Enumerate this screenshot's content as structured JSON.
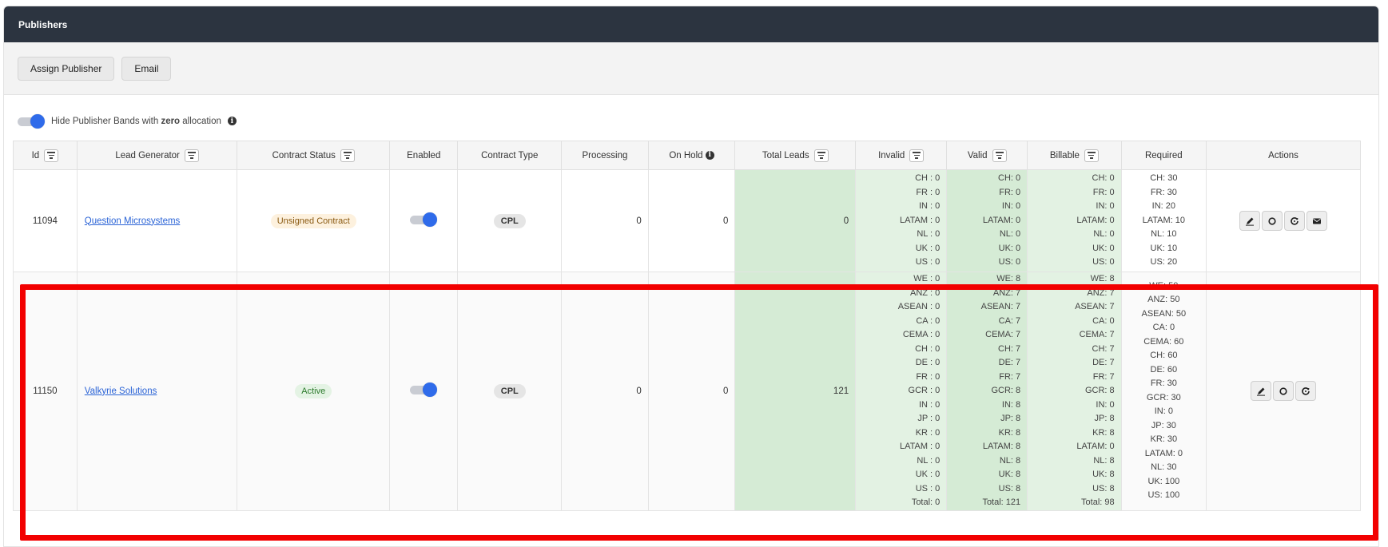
{
  "header": {
    "title": "Publishers"
  },
  "toolbar": {
    "assign_label": "Assign Publisher",
    "email_label": "Email"
  },
  "filter_toggle": {
    "text_before": "Hide Publisher Bands with ",
    "text_bold": "zero",
    "text_after": " allocation",
    "info": "i",
    "on": true
  },
  "table": {
    "headers": {
      "id": "Id",
      "lead_generator": "Lead Generator",
      "contract_status": "Contract Status",
      "enabled": "Enabled",
      "contract_type": "Contract Type",
      "processing": "Processing",
      "on_hold": "On Hold",
      "total_leads": "Total Leads",
      "invalid": "Invalid",
      "valid": "Valid",
      "billable": "Billable",
      "required": "Required",
      "actions": "Actions"
    },
    "rows": [
      {
        "id": "11094",
        "lead_generator": "Question Microsystems",
        "contract_status": "Unsigned Contract",
        "enabled": true,
        "contract_type": "CPL",
        "processing": "0",
        "on_hold": "0",
        "total_leads": "0",
        "invalid": [
          "CH : 0",
          "FR : 0",
          "IN : 0",
          "LATAM : 0",
          "NL : 0",
          "UK : 0",
          "US : 0"
        ],
        "valid": [
          "CH: 0",
          "FR: 0",
          "IN: 0",
          "LATAM: 0",
          "NL: 0",
          "UK: 0",
          "US: 0"
        ],
        "billable": [
          "CH: 0",
          "FR: 0",
          "IN: 0",
          "LATAM: 0",
          "NL: 0",
          "UK: 0",
          "US: 0"
        ],
        "required": [
          "CH: 30",
          "FR: 30",
          "IN: 20",
          "LATAM: 10",
          "NL: 10",
          "UK: 10",
          "US: 20"
        ]
      },
      {
        "id": "11150",
        "lead_generator": "Valkyrie Solutions",
        "contract_status": "Active",
        "enabled": true,
        "contract_type": "CPL",
        "processing": "0",
        "on_hold": "0",
        "total_leads": "121",
        "invalid": [
          "WE : 0",
          "ANZ : 0",
          "ASEAN : 0",
          "CA : 0",
          "CEMA : 0",
          "CH : 0",
          "DE : 0",
          "FR : 0",
          "GCR : 0",
          "IN : 0",
          "JP : 0",
          "KR : 0",
          "LATAM : 0",
          "NL : 0",
          "UK : 0",
          "US : 0",
          "Total: 0"
        ],
        "valid": [
          "WE: 8",
          "ANZ: 7",
          "ASEAN: 7",
          "CA: 7",
          "CEMA: 7",
          "CH: 7",
          "DE: 7",
          "FR: 7",
          "GCR: 8",
          "IN: 8",
          "JP: 8",
          "KR: 8",
          "LATAM: 8",
          "NL: 8",
          "UK: 8",
          "US: 8",
          "Total: 121"
        ],
        "billable": [
          "WE: 8",
          "ANZ: 7",
          "ASEAN: 7",
          "CA: 0",
          "CEMA: 7",
          "CH: 7",
          "DE: 7",
          "FR: 7",
          "GCR: 8",
          "IN: 0",
          "JP: 8",
          "KR: 8",
          "LATAM: 0",
          "NL: 8",
          "UK: 8",
          "US: 8",
          "Total: 98"
        ],
        "required": [
          "WE: 50",
          "ANZ: 50",
          "ASEAN: 50",
          "CA: 0",
          "CEMA: 60",
          "CH: 60",
          "DE: 60",
          "FR: 30",
          "GCR: 30",
          "IN: 0",
          "JP: 30",
          "KR: 30",
          "LATAM: 0",
          "NL: 30",
          "UK: 100",
          "US: 100"
        ]
      }
    ]
  },
  "icons": [
    "pencil-icon",
    "circle-icon",
    "refresh-icon",
    "envelope-icon",
    "filter-icon",
    "info-icon"
  ],
  "colors": {
    "header_bg": "#2c3440",
    "toggle_on": "#2f6bea",
    "link": "#2a63d6",
    "highlight": "#f20000",
    "green_cell": "#d5ebd5"
  }
}
